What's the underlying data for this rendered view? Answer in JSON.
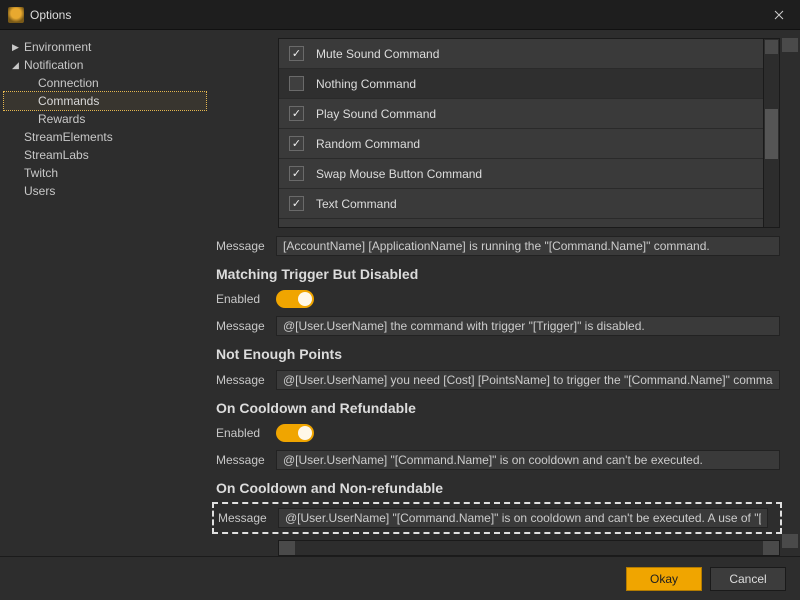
{
  "window": {
    "title": "Options"
  },
  "sidebar": {
    "items": [
      {
        "label": "Environment",
        "expandable": true,
        "expanded": false,
        "children": []
      },
      {
        "label": "Notification",
        "expandable": true,
        "expanded": true,
        "children": [
          {
            "label": "Connection"
          },
          {
            "label": "Commands",
            "selected": true
          },
          {
            "label": "Rewards"
          }
        ]
      },
      {
        "label": "StreamElements",
        "expandable": false
      },
      {
        "label": "StreamLabs",
        "expandable": false
      },
      {
        "label": "Twitch",
        "expandable": false
      },
      {
        "label": "Users",
        "expandable": false
      }
    ]
  },
  "command_list": [
    {
      "label": "Mute Sound Command",
      "checked": true
    },
    {
      "label": "Nothing Command",
      "checked": false
    },
    {
      "label": "Play Sound Command",
      "checked": true
    },
    {
      "label": "Random Command",
      "checked": true
    },
    {
      "label": "Swap Mouse Button Command",
      "checked": true
    },
    {
      "label": "Text Command",
      "checked": true
    }
  ],
  "sections": {
    "running": {
      "message_label": "Message",
      "message_value": "[AccountName] [ApplicationName] is running the \"[Command.Name]\" command."
    },
    "trigger_disabled": {
      "heading": "Matching Trigger But Disabled",
      "enabled_label": "Enabled",
      "enabled": true,
      "message_label": "Message",
      "message_value": "@[User.UserName] the command with trigger \"[Trigger]\" is disabled."
    },
    "not_enough_points": {
      "heading": "Not Enough Points",
      "message_label": "Message",
      "message_value": "@[User.UserName] you need [Cost] [PointsName] to trigger the \"[Command.Name]\" command."
    },
    "cooldown_refundable": {
      "heading": "On Cooldown and Refundable",
      "enabled_label": "Enabled",
      "enabled": true,
      "message_label": "Message",
      "message_value": "@[User.UserName] \"[Command.Name]\" is on cooldown and can't be executed."
    },
    "cooldown_nonrefundable": {
      "heading": "On Cooldown and Non-refundable",
      "message_label": "Message",
      "message_value": "@[User.UserName] \"[Command.Name]\" is on cooldown and can't be executed. A use of \"[Command.N"
    }
  },
  "footer": {
    "okay": "Okay",
    "cancel": "Cancel"
  }
}
